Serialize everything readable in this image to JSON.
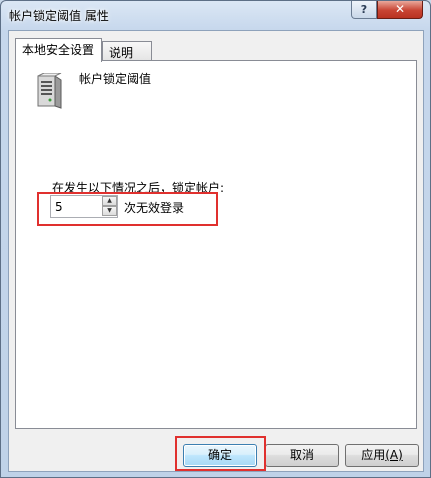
{
  "window": {
    "title": "帐户锁定阈值 属性",
    "help_label": "?",
    "close_label": "✕"
  },
  "tabs": [
    {
      "label": "本地安全设置",
      "active": true
    },
    {
      "label": "说明",
      "active": false
    }
  ],
  "policy": {
    "name": "帐户锁定阈值",
    "icon": "server-policy-icon",
    "prompt": "在发生以下情况之后，锁定帐户:",
    "value": "5",
    "unit_label": "次无效登录"
  },
  "buttons": {
    "ok": "确定",
    "cancel": "取消",
    "apply": "应用",
    "apply_mnemonic": "(A)"
  },
  "colors": {
    "highlight": "#e0302e",
    "titlebar": "#c6d7ec"
  }
}
